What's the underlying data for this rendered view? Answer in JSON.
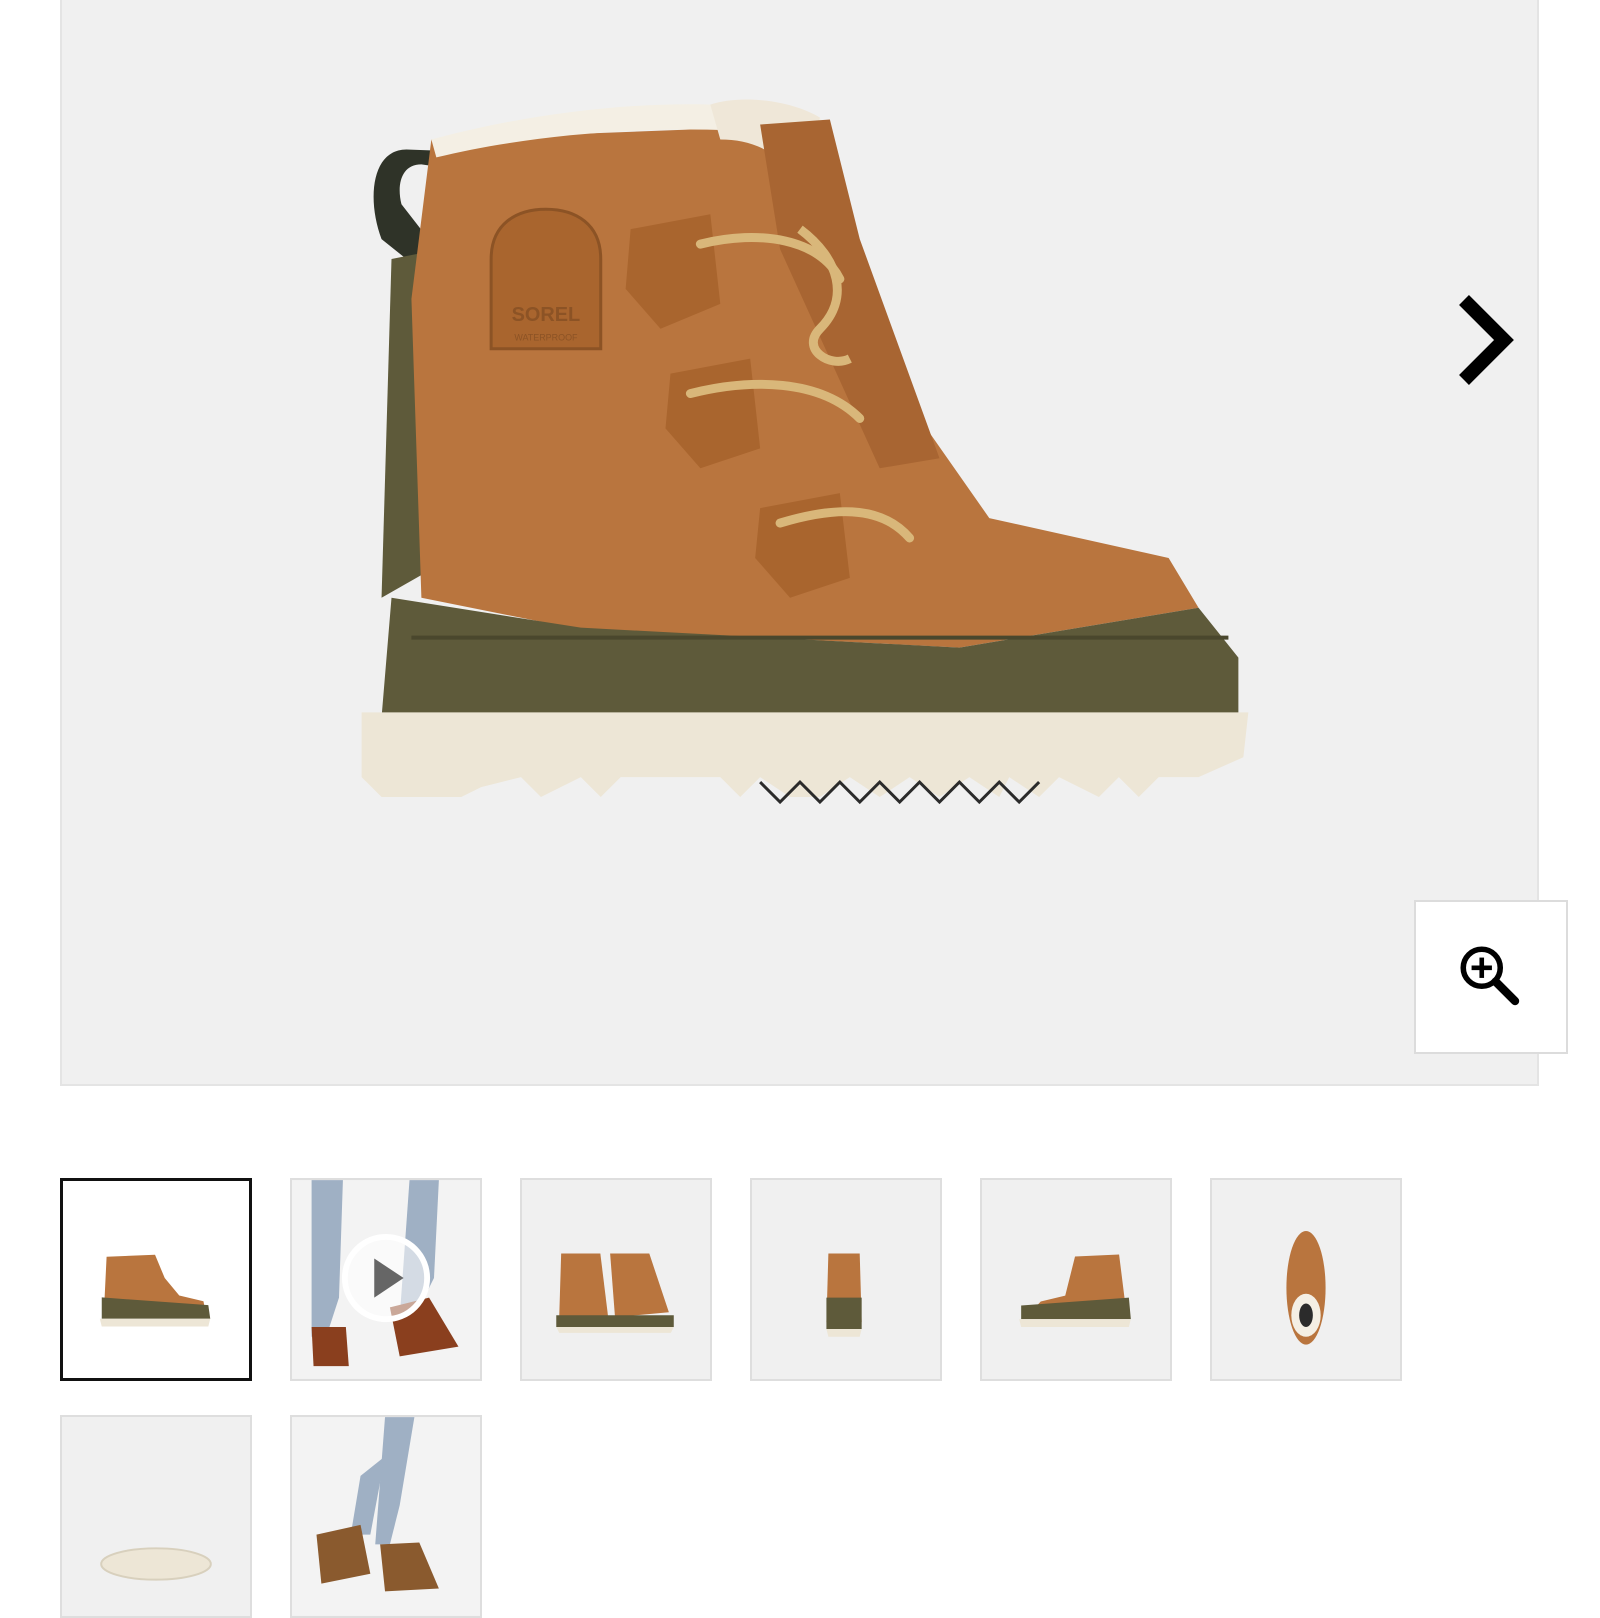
{
  "gallery": {
    "main_image": {
      "alt": "SOREL Tivoli IV waterproof boot side view",
      "brand_mark": "SOREL",
      "patch_text": "WATERPROOF"
    },
    "next_icon": "chevron-right-icon",
    "zoom_icon": "zoom-in-icon",
    "thumbnails": [
      {
        "view": "side",
        "selected": true
      },
      {
        "view": "video",
        "icon": "play-icon"
      },
      {
        "view": "pair"
      },
      {
        "view": "back"
      },
      {
        "view": "side-inner"
      },
      {
        "view": "top"
      },
      {
        "view": "sole"
      },
      {
        "view": "model-walking"
      }
    ],
    "colors": {
      "suede": "#B9753E",
      "rubber": "#5E5A3A",
      "outsole": "#EDE6D6",
      "lace": "#D9B77A",
      "background": "#F0F0F0"
    }
  }
}
